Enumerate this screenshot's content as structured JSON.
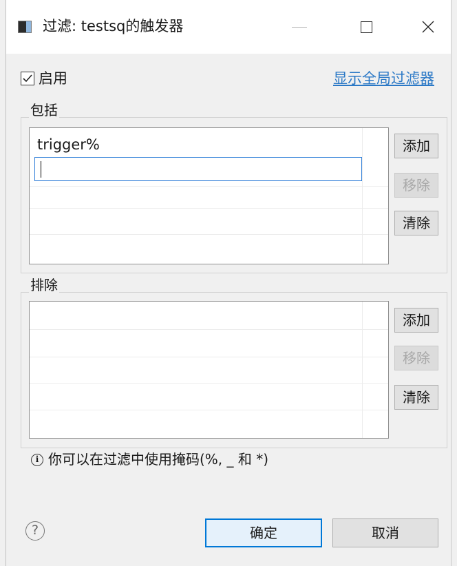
{
  "window": {
    "title": "过滤: testsq的触发器",
    "minimize_icon": "minimize-icon",
    "maximize_icon": "maximize-icon",
    "close_icon": "close-icon",
    "close_glyph": "✕"
  },
  "enable": {
    "checked": true,
    "label": "启用"
  },
  "show_global_link": "显示全局过滤器",
  "include": {
    "group_label": "包括",
    "entries": [
      "trigger%"
    ],
    "editing_value": "",
    "buttons": {
      "add": "添加",
      "remove": "移除",
      "clear": "清除"
    }
  },
  "exclude": {
    "group_label": "排除",
    "entries": [],
    "buttons": {
      "add": "添加",
      "remove": "移除",
      "clear": "清除"
    }
  },
  "info": {
    "icon": "info-icon",
    "glyph": "i",
    "text": "你可以在过滤中使用掩码(%, _ 和 *)"
  },
  "footer": {
    "help_glyph": "?",
    "ok_label": "确定",
    "cancel_label": "取消"
  },
  "colors": {
    "link": "#2a78c6",
    "focus": "#0078d7",
    "dialog_bg": "#f0f0f0"
  }
}
